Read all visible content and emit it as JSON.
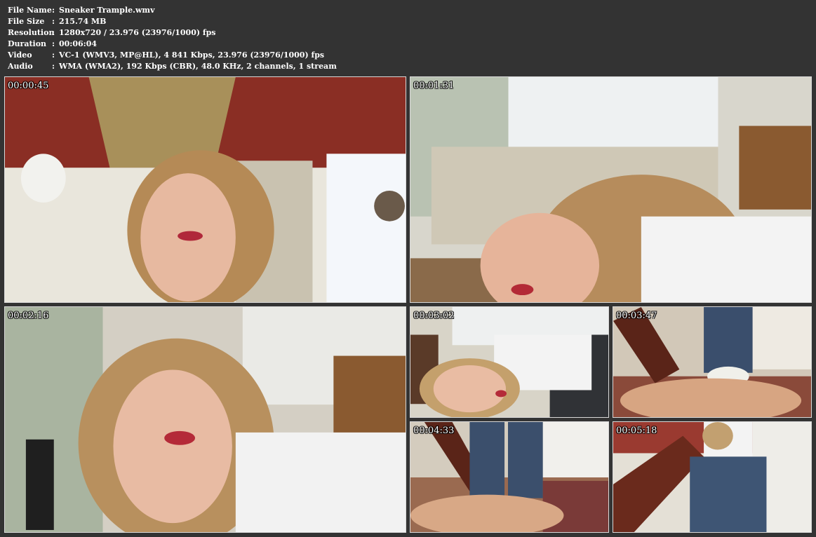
{
  "file_info": [
    {
      "label": "File Name",
      "value": "Sneaker Trample.wmv"
    },
    {
      "label": "File Size",
      "value": "215.74 MB"
    },
    {
      "label": "Resolution",
      "value": "1280x720 / 23.976 (23976/1000) fps"
    },
    {
      "label": "Duration",
      "value": "00:06:04"
    },
    {
      "label": "Video",
      "value": "VC-1 (WMV3, MP@HL), 4 841 Kbps, 23.976 (23976/1000) fps"
    },
    {
      "label": "Audio",
      "value": "WMA (WMA2), 192 Kbps (CBR), 48.0 KHz, 2 channels, 1 stream"
    }
  ],
  "separator": ":",
  "thumbnails": [
    {
      "timestamp": "00:00:45"
    },
    {
      "timestamp": "00:01:31"
    },
    {
      "timestamp": "00:02:16"
    },
    {
      "timestamp": "00:03:02"
    },
    {
      "timestamp": "00:03:47"
    },
    {
      "timestamp": "00:04:33"
    },
    {
      "timestamp": "00:05:18"
    }
  ],
  "colors": {
    "background": "#333333",
    "text": "#ffffff",
    "thumb_border": "#d8d8d8"
  }
}
